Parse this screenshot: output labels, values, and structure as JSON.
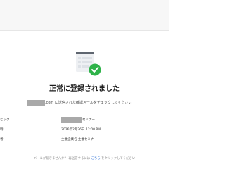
{
  "header": {
    "bar": ""
  },
  "main": {
    "illustration_icon": "registration-check-icon",
    "accent_color": "#2fb34a",
    "title": "正常に登録されました",
    "confirmation_suffix": ".com に送信された確認メールをチェックしてください"
  },
  "details": {
    "topic_label": "ピック",
    "topic_value_suffix": "セミナー",
    "datetime_label": "時",
    "datetime_value": "2026年2月26日 12:00 PM",
    "host_label": "者",
    "host_value": "主催企業名 主催セミナー"
  },
  "footer": {
    "prefix": "メールが届きませんか？ 再送信するには ",
    "link": "こちら",
    "suffix": " をクリックしてください"
  }
}
